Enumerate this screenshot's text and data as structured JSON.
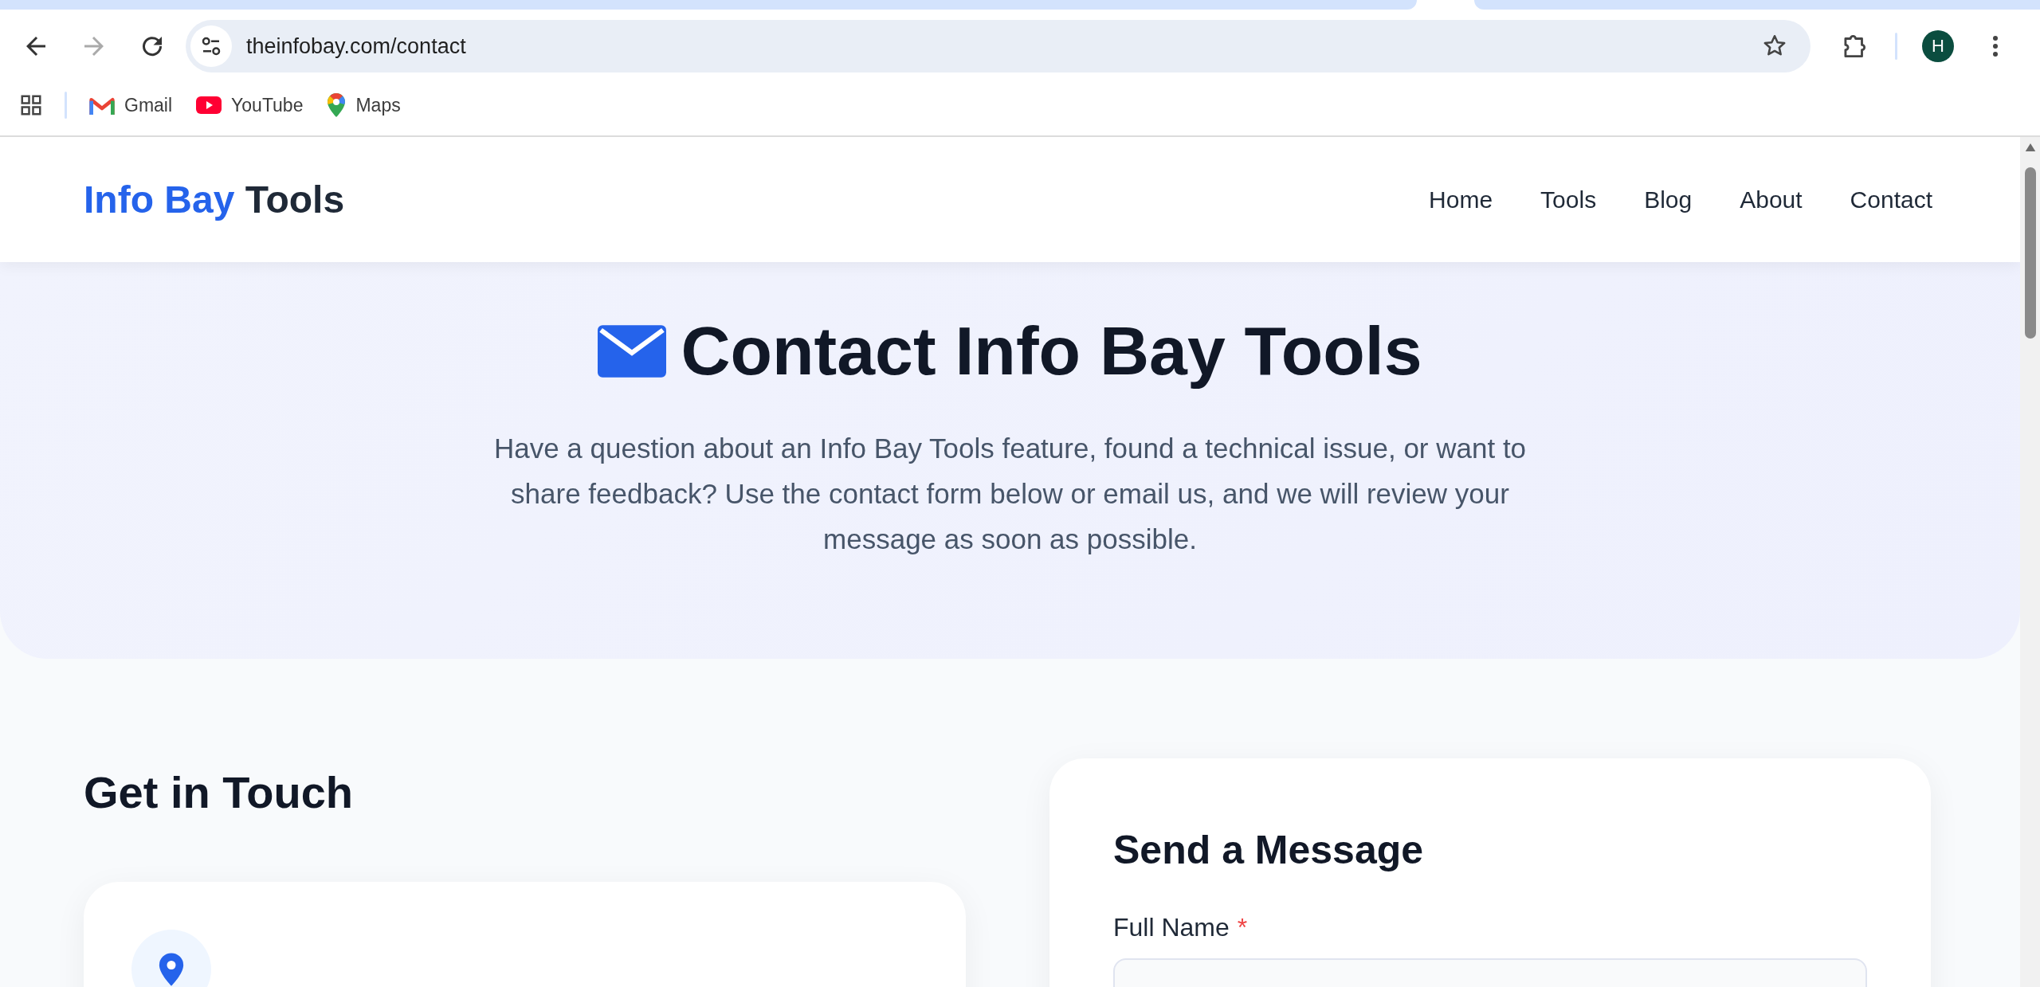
{
  "browser": {
    "url": "theinfobay.com/contact",
    "back_disabled": false,
    "forward_disabled": true,
    "profile_initial": "H",
    "bookmarks": [
      {
        "label": "Gmail",
        "kind": "gmail"
      },
      {
        "label": "YouTube",
        "kind": "youtube"
      },
      {
        "label": "Maps",
        "kind": "maps"
      }
    ]
  },
  "site": {
    "logo_accent": "Info Bay",
    "logo_rest": "Tools",
    "nav": [
      "Home",
      "Tools",
      "Blog",
      "About",
      "Contact"
    ]
  },
  "hero": {
    "title": "Contact Info Bay Tools",
    "intro": "Have a question about an Info Bay Tools feature, found a technical issue, or want to share feedback? Use the contact form below or email us, and we will review your message as soon as possible."
  },
  "contact_info": {
    "heading": "Get in Touch"
  },
  "form": {
    "heading": "Send a Message",
    "fields": [
      {
        "label": "Full Name",
        "required": true,
        "required_mark": "*"
      }
    ]
  }
}
